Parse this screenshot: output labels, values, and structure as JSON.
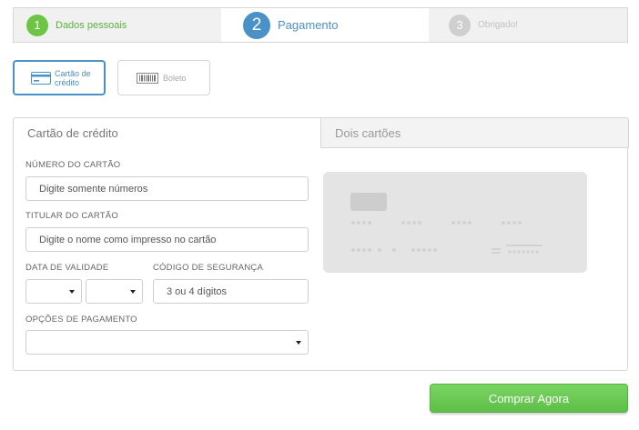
{
  "stepper": {
    "steps": [
      {
        "number": "1",
        "label": "Dados pessoais",
        "state": "done"
      },
      {
        "number": "2",
        "label": "Pagamento",
        "state": "active"
      },
      {
        "number": "3",
        "label": "Obrigado!",
        "state": "pending"
      }
    ]
  },
  "methods": {
    "card_label_line1": "Cartão de",
    "card_label_line2": "crédito",
    "boleto_label": "Boleto",
    "selected": "card"
  },
  "tabs": {
    "credit": "Cartão de crédito",
    "two_cards": "Dois cartões"
  },
  "form": {
    "card_number_label": "NÚMERO DO CARTÃO",
    "card_number_placeholder": "Digite somente números",
    "holder_label": "TITULAR DO CARTÃO",
    "holder_placeholder": "Digite o nome como impresso no cartão",
    "expiry_label": "DATA DE VALIDADE",
    "expiry_month_value": "",
    "expiry_year_value": "",
    "cvv_label": "CÓDIGO DE SEGURANÇA",
    "cvv_placeholder": "3 ou 4 dígitos",
    "installments_label": "OPÇÕES DE PAGAMENTO",
    "installments_value": ""
  },
  "submit_label": "Comprar Agora",
  "colors": {
    "accent_blue": "#4a90c9",
    "done_green": "#6cc644",
    "button_green": "#5dbf47",
    "card_gray": "#e4e4e4"
  }
}
